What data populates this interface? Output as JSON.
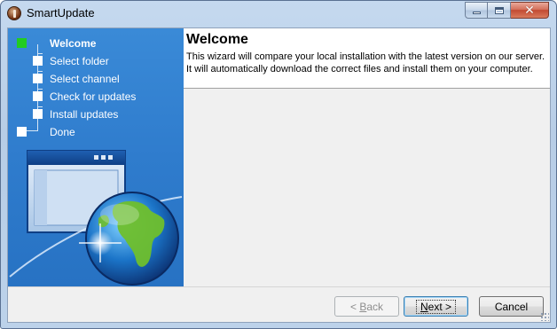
{
  "window": {
    "title": "SmartUpdate",
    "controls": {
      "minimize": "minimize-icon",
      "maximize": "maximize-icon",
      "close": "close-icon"
    }
  },
  "steps": [
    {
      "label": "Welcome",
      "active": true
    },
    {
      "label": "Select folder",
      "active": false
    },
    {
      "label": "Select channel",
      "active": false
    },
    {
      "label": "Check for updates",
      "active": false
    },
    {
      "label": "Install updates",
      "active": false
    },
    {
      "label": "Done",
      "active": false
    }
  ],
  "page": {
    "title": "Welcome",
    "description_line1": "This wizard will compare your local installation with the latest version on our server.",
    "description_line2": "It will automatically download the correct files and install them on your computer."
  },
  "buttons": {
    "back": {
      "label": "< Back",
      "mnemonic": "B",
      "enabled": false
    },
    "next": {
      "label": "Next >",
      "mnemonic": "N",
      "enabled": true
    },
    "cancel": {
      "label": "Cancel",
      "enabled": true
    }
  },
  "colors": {
    "sidebar": "#2f7ccd",
    "active_step_marker": "#22cc22",
    "window_frame": "#b9cfe8",
    "close_button": "#c24a32"
  }
}
